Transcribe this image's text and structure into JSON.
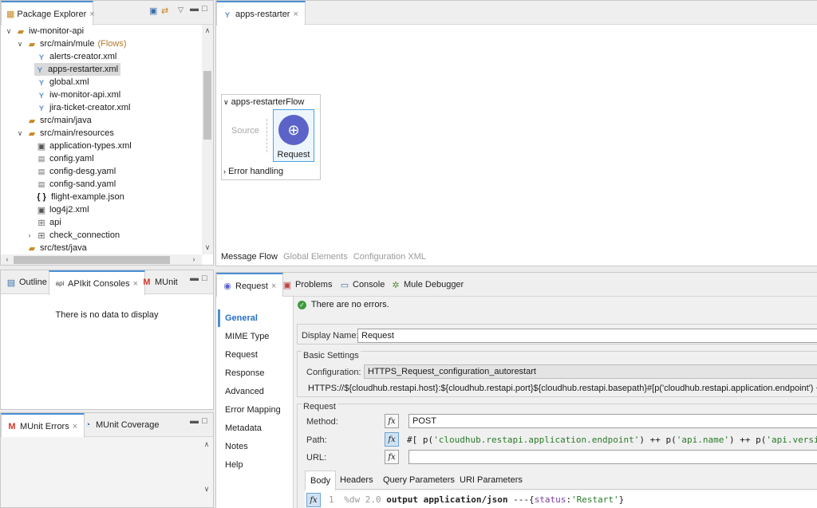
{
  "package_explorer": {
    "tab_label": "Package Explorer",
    "tree": [
      {
        "label": "iw-monitor-api",
        "suffix": "",
        "icon": "project-icon",
        "twisty": "expanded"
      },
      {
        "label": "src/main/mule",
        "suffix": "(Flows)",
        "icon": "folder-icon",
        "twisty": "expanded"
      },
      {
        "label": "alerts-creator.xml",
        "suffix": "",
        "icon": "mule-file-icon",
        "twisty": ""
      },
      {
        "label": "apps-restarter.xml",
        "suffix": "",
        "icon": "mule-file-icon",
        "twisty": ""
      },
      {
        "label": "global.xml",
        "suffix": "",
        "icon": "mule-file-icon",
        "twisty": ""
      },
      {
        "label": "iw-monitor-api.xml",
        "suffix": "",
        "icon": "mule-file-icon",
        "twisty": ""
      },
      {
        "label": "jira-ticket-creator.xml",
        "suffix": "",
        "icon": "mule-file-icon",
        "twisty": ""
      },
      {
        "label": "src/main/java",
        "suffix": "",
        "icon": "folder-icon",
        "twisty": ""
      },
      {
        "label": "src/main/resources",
        "suffix": "",
        "icon": "folder-icon",
        "twisty": "expanded"
      },
      {
        "label": "application-types.xml",
        "suffix": "",
        "icon": "xml-file-icon",
        "twisty": ""
      },
      {
        "label": "config.yaml",
        "suffix": "",
        "icon": "yaml-file-icon",
        "twisty": ""
      },
      {
        "label": "config-desg.yaml",
        "suffix": "",
        "icon": "yaml-file-icon",
        "twisty": ""
      },
      {
        "label": "config-sand.yaml",
        "suffix": "",
        "icon": "yaml-file-icon",
        "twisty": ""
      },
      {
        "label": "flight-example.json",
        "suffix": "",
        "icon": "json-file-icon",
        "twisty": ""
      },
      {
        "label": "log4j2.xml",
        "suffix": "",
        "icon": "xml-file-icon",
        "twisty": ""
      },
      {
        "label": "api",
        "suffix": "",
        "icon": "package-icon",
        "twisty": ""
      },
      {
        "label": "check_connection",
        "suffix": "",
        "icon": "package-icon",
        "twisty": "collapsed"
      },
      {
        "label": "src/test/java",
        "suffix": "",
        "icon": "folder-icon",
        "twisty": ""
      }
    ]
  },
  "outline_panel": {
    "tabs": [
      "Outline",
      "APIkit Consoles",
      "MUnit"
    ],
    "empty_message": "There is no data to display"
  },
  "munit_panel": {
    "tabs": [
      "MUnit Errors",
      "MUnit Coverage"
    ]
  },
  "editor": {
    "tab_label": "apps-restarter",
    "flow_name": "apps-restarterFlow",
    "source_label": "Source",
    "component_label": "Request",
    "error_handling_label": "Error handling",
    "bottom_tabs": [
      "Message Flow",
      "Global Elements",
      "Configuration XML"
    ]
  },
  "properties": {
    "tabs": [
      "Request",
      "Problems",
      "Console",
      "Mule Debugger"
    ],
    "status_message": "There are no errors.",
    "nav": [
      "General",
      "MIME Type",
      "Request",
      "Response",
      "Advanced",
      "Error Mapping",
      "Metadata",
      "Notes",
      "Help"
    ],
    "display_name_label": "Display Name:",
    "display_name_value": "Request",
    "basic_settings_label": "Basic Settings",
    "configuration_label": "Configuration:",
    "configuration_value": "HTTPS_Request_configuration_autorestart",
    "url_preview": "HTTPS://${cloudhub.restapi.host}:${cloudhub.restapi.port}${cloudhub.restapi.basepath}#[p('cloudhub.restapi.application.endpoint') ++ p('ap",
    "request_group_label": "Request",
    "method_label": "Method:",
    "method_value": "POST",
    "path_label": "Path:",
    "path_code": {
      "p1": "#[ p(",
      "s1": "'cloudhub.restapi.application.endpoint'",
      "p2": ") ++ p(",
      "s2": "'api.name'",
      "p3": ") ++ p(",
      "s3": "'api.version'",
      "p4": ")"
    },
    "url_label": "URL:",
    "url_value": "",
    "body_tabs": [
      "Body",
      "Headers",
      "Query Parameters",
      "URI Parameters"
    ],
    "body_code": {
      "line_no": "1",
      "directive": "%dw 2.0",
      "output": "output application/json",
      "sep": "---{",
      "key": "status",
      "colon": ":",
      "val": "'Restart'",
      "close": "}"
    }
  }
}
